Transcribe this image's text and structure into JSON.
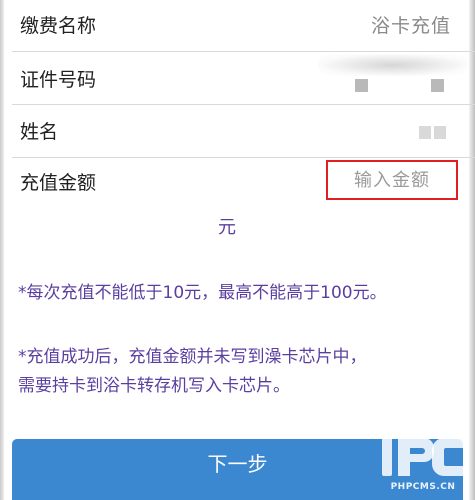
{
  "form": {
    "fee_name": {
      "label": "缴费名称",
      "value": "浴卡充值"
    },
    "id_number": {
      "label": "证件号码"
    },
    "name": {
      "label": "姓名"
    },
    "recharge_amount": {
      "label": "充值金额",
      "placeholder": "输入金额",
      "unit": "元"
    }
  },
  "notes": {
    "limit": "*每次充值不能低于10元，最高不能高于100元。",
    "success_line1": "*充值成功后，充值金额并未写到澡卡芯片中，",
    "success_line2": "需要持卡到浴卡转存机写入卡芯片。"
  },
  "actions": {
    "next_label": "下一步"
  },
  "watermark": {
    "text": "PHPCMS.CN"
  },
  "colors": {
    "accent_button": "#3b87d0",
    "note_text": "#5b3fa0",
    "highlight_border": "#e02020"
  }
}
